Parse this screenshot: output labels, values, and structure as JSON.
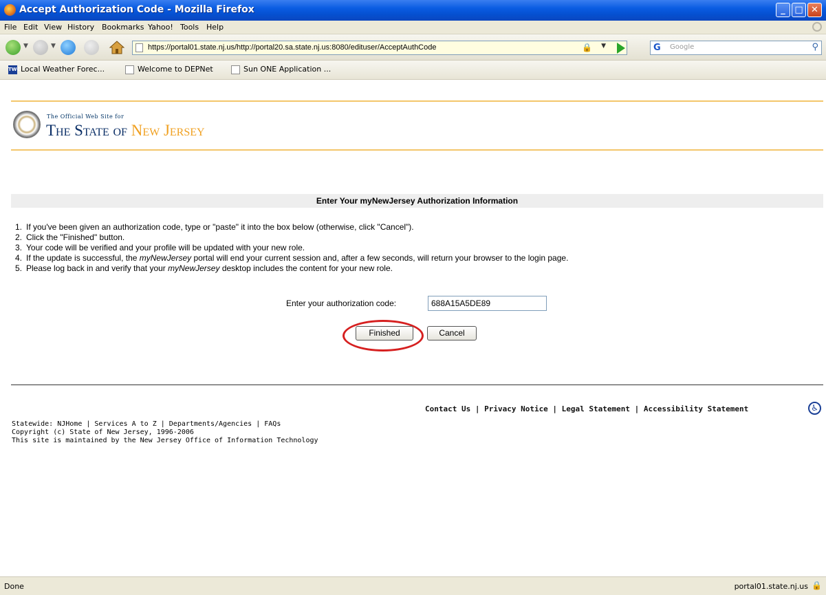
{
  "window": {
    "title": "Accept Authorization Code - Mozilla Firefox",
    "min_glyph": "_",
    "max_glyph": "□",
    "close_glyph": "✕"
  },
  "menu": [
    "File",
    "Edit",
    "View",
    "History",
    "Bookmarks",
    "Yahoo!",
    "Tools",
    "Help"
  ],
  "nav": {
    "url": "https://portal01.state.nj.us/http://portal20.sa.state.nj.us:8080/edituser/AcceptAuthCode",
    "search_placeholder": "Google",
    "search_logo": "G"
  },
  "bookmarks": [
    {
      "label": "Local Weather Forec...",
      "icon": "twc-icon"
    },
    {
      "label": "Welcome to DEPNet",
      "icon": "page-icon"
    },
    {
      "label": "Sun ONE Application ...",
      "icon": "page-icon"
    }
  ],
  "header": {
    "official": "The Official Web Site for",
    "state_prefix": "The State of",
    "state_name": "New Jersey"
  },
  "main": {
    "heading": "Enter Your myNewJersey Authorization Information",
    "steps": [
      {
        "num": "1.",
        "text": "If you've been given an authorization code, type or \"paste\" it into the box below (otherwise, click \"Cancel\")."
      },
      {
        "num": "2.",
        "text": "Click the \"Finished\" button."
      },
      {
        "num": "3.",
        "text": "Your code will be verified and your profile will be updated with your new role."
      },
      {
        "num": "4.",
        "pre": "If the update is successful, the ",
        "em": "myNewJersey",
        "post": " portal will end your current session and, after a few seconds, will return your browser to the login page."
      },
      {
        "num": "5.",
        "pre": "Please log back in and verify that your ",
        "em": "myNewJersey",
        "post": " desktop includes the content for your new role."
      }
    ],
    "code_label": "Enter your authorization code:",
    "code_value": "688A15A5DE89",
    "finished_label": "Finished",
    "cancel_label": "Cancel"
  },
  "footer": {
    "links": "Contact Us | Privacy Notice | Legal Statement | Accessibility Statement",
    "statewide": "Statewide: NJHome | Services A to Z | Departments/Agencies | FAQs",
    "copyright": "Copyright (c) State of New Jersey, 1996-2006",
    "maintained": "This site is maintained by the New Jersey Office of Information Technology"
  },
  "status": {
    "text": "Done",
    "host": "portal01.state.nj.us"
  },
  "colors": {
    "titlebar": "#0a5ce2",
    "rule": "#f3c66a",
    "highlight": "#d62020",
    "nj_gold": "#f0a020"
  }
}
